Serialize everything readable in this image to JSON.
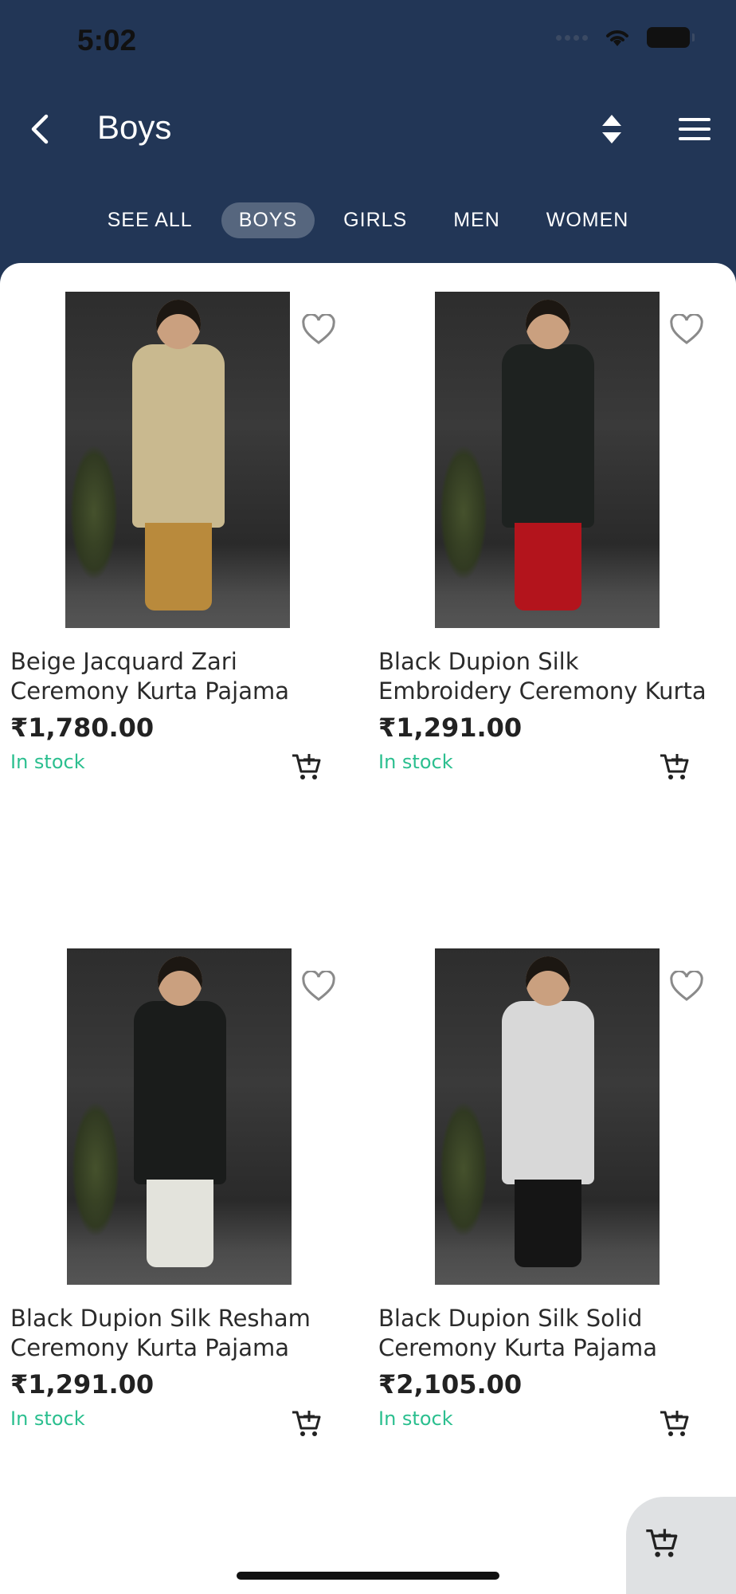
{
  "status_bar": {
    "time": "5:02"
  },
  "header": {
    "title": "Boys"
  },
  "tabs": [
    {
      "label": "SEE ALL",
      "active": false
    },
    {
      "label": "BOYS",
      "active": true
    },
    {
      "label": "GIRLS",
      "active": false
    },
    {
      "label": "MEN",
      "active": false
    },
    {
      "label": "WOMEN",
      "active": false
    }
  ],
  "products": [
    {
      "name_line1": "Beige Jacquard Zari",
      "name_line2": "Ceremony Kurta Pajama",
      "price": "₹1,780.00",
      "stock": "In stock",
      "kurta_color": "#c9b98f",
      "pajama_color": "#b98a3c"
    },
    {
      "name_line1": "Black Dupion Silk",
      "name_line2": "Embroidery Ceremony Kurta",
      "price": "₹1,291.00",
      "stock": "In stock",
      "kurta_color": "#1e2220",
      "pajama_color": "#b3141c"
    },
    {
      "name_line1": "Black Dupion Silk Resham",
      "name_line2": "Ceremony Kurta Pajama",
      "price": "₹1,291.00",
      "stock": "In stock",
      "kurta_color": "#1a1c1b",
      "pajama_color": "#e3e3dc"
    },
    {
      "name_line1": "Black Dupion Silk Solid",
      "name_line2": "Ceremony Kurta Pajama",
      "price": "₹2,105.00",
      "stock": "In stock",
      "kurta_color": "#d8d8d8",
      "pajama_color": "#151515"
    }
  ],
  "colors": {
    "header_bg": "#223656",
    "stock_green": "#2bbf8f",
    "active_tab_bg": "#56667e"
  }
}
